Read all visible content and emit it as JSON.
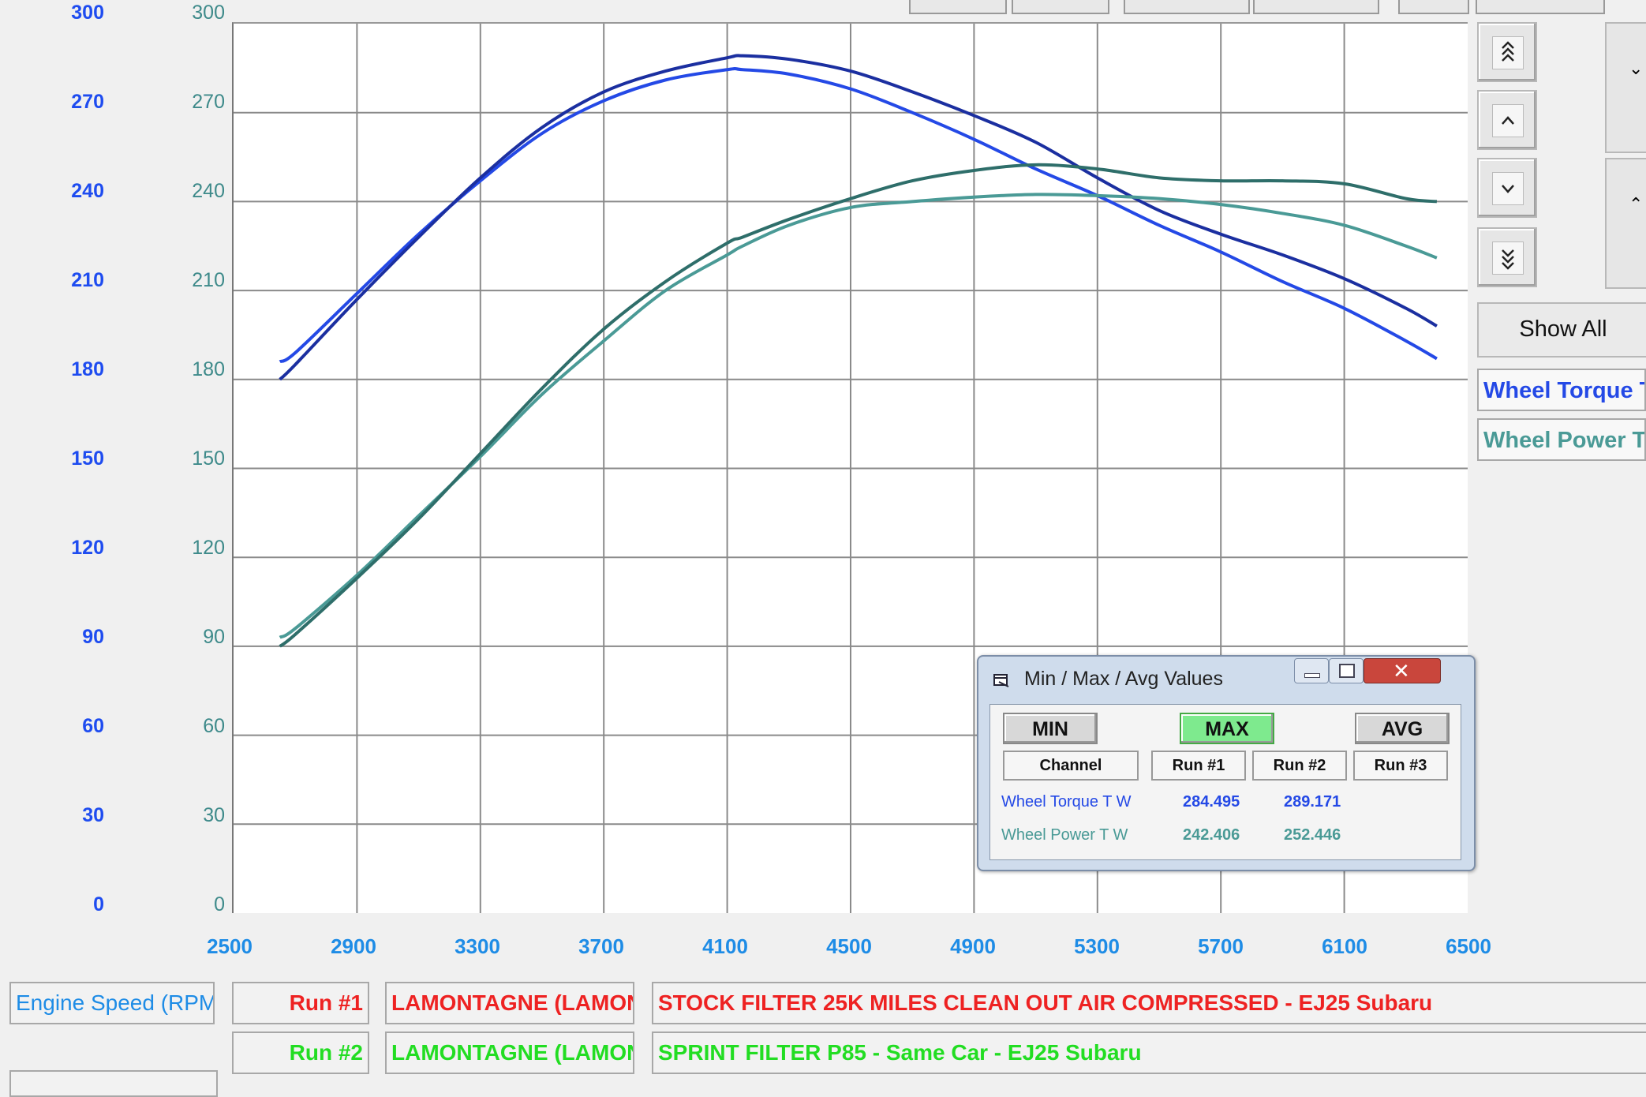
{
  "colors": {
    "torque_run1": "#2449e6",
    "torque_run2": "#1b2fa0",
    "power_run1": "#4a9a96",
    "power_run2": "#2e6e6a",
    "run1_red": "#ee2222",
    "run2_green": "#22dd22",
    "accent_blue": "#1e8ce6"
  },
  "chart_data": {
    "type": "line",
    "x": [
      2650,
      2700,
      2900,
      3100,
      3300,
      3500,
      3700,
      3900,
      4100,
      4150,
      4300,
      4500,
      4700,
      4900,
      5100,
      5300,
      5500,
      5700,
      5900,
      6100,
      6300,
      6400
    ],
    "xlim": [
      2500,
      6500
    ],
    "ylim": [
      0,
      300
    ],
    "x_ticks": [
      "2500",
      "2900",
      "3300",
      "3700",
      "4100",
      "4500",
      "4900",
      "5300",
      "5700",
      "6100",
      "6500"
    ],
    "y_ticks_left": [
      "300",
      "270",
      "240",
      "210",
      "180",
      "150",
      "120",
      "90",
      "60",
      "30",
      "0"
    ],
    "y_ticks_right": [
      "300",
      "270",
      "240",
      "210",
      "180",
      "150",
      "120",
      "90",
      "60",
      "30",
      "0"
    ],
    "grid": true,
    "series": [
      {
        "values": [
          186,
          189,
          209,
          229,
          247,
          263,
          274,
          281,
          284.5,
          284.5,
          283,
          278,
          270,
          261,
          251,
          242,
          232,
          223,
          213,
          204,
          193,
          187
        ]
      },
      {
        "values": [
          180,
          185,
          207,
          228,
          248,
          265,
          277,
          284,
          288.5,
          289.2,
          288,
          284,
          277,
          269,
          260,
          248,
          237,
          229,
          222,
          214,
          204,
          198
        ]
      },
      {
        "values": [
          93,
          96,
          114,
          134,
          154,
          175,
          193,
          210,
          222,
          225,
          232,
          238,
          240,
          241.5,
          242.4,
          242,
          241,
          239,
          236,
          232,
          225,
          221
        ]
      },
      {
        "values": [
          90,
          94,
          113,
          133,
          155,
          177,
          197,
          213,
          226,
          228,
          234,
          241,
          247,
          250.5,
          252.4,
          251,
          248,
          247,
          247,
          246,
          241,
          240
        ]
      }
    ]
  },
  "right_panel": {
    "show_all": "Show All",
    "channels": [
      "Wheel Torque T Wheel",
      "Wheel Power T Wheel"
    ]
  },
  "bottom": {
    "x_channel": "Engine Speed (RPM)",
    "runs": [
      {
        "label": "Run #1",
        "owner": "LAMONTAGNE (LAMONTAGNE)",
        "description": "STOCK FILTER 25K MILES CLEAN OUT AIR COMPRESSED - EJ25 Subaru"
      },
      {
        "label": "Run #2",
        "owner": "LAMONTAGNE (LAMONTAGNE)",
        "description": "SPRINT FILTER P85 - Same Car - EJ25 Subaru"
      }
    ]
  },
  "dialog": {
    "title": "Min / Max / Avg Values",
    "buttons": {
      "min": "MIN",
      "max": "MAX",
      "avg": "AVG"
    },
    "headers": {
      "channel": "Channel",
      "run1": "Run #1",
      "run2": "Run #2",
      "run3": "Run #3"
    },
    "rows": [
      {
        "channel": "Wheel Torque T W",
        "run1": "284.495",
        "run2": "289.171",
        "run3": ""
      },
      {
        "channel": "Wheel Power T W",
        "run1": "242.406",
        "run2": "252.446",
        "run3": ""
      }
    ]
  }
}
